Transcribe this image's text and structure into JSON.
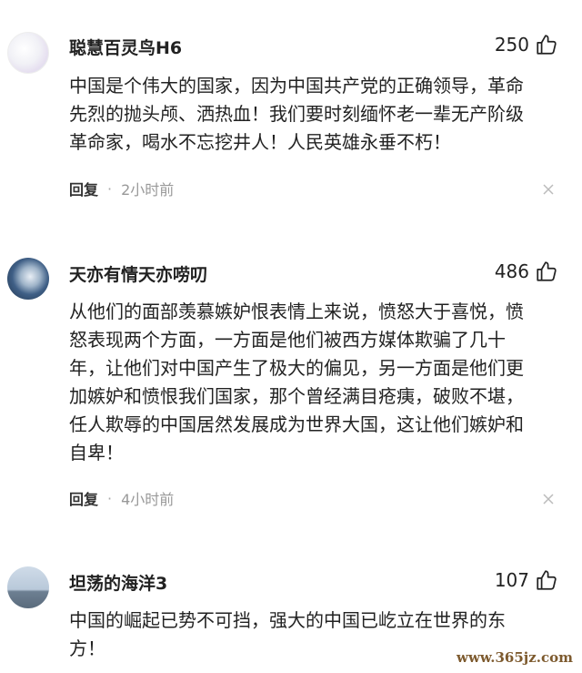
{
  "comments": [
    {
      "username": "聪慧百灵鸟H6",
      "likes": "250",
      "text": "中国是个伟大的国家，因为中国共产党的正确领导，革命\n先烈的抛头颅、洒热血！我们要时刻缅怀老一辈无产阶级\n革命家，喝水不忘挖井人！人民英雄永垂不朽！",
      "reply_label": "回复",
      "separator": "·",
      "time": "2小时前"
    },
    {
      "username": "天亦有情天亦唠叨",
      "likes": "486",
      "text": "从他们的面部羡慕嫉妒恨表情上来说，愤怒大于喜悦，愤\n怒表现两个方面，一方面是他们被西方媒体欺骗了几十\n年，让他们对中国产生了极大的偏见，另一方面是他们更\n加嫉妒和愤恨我们国家，那个曾经满目疮痍，破败不堪，\n任人欺辱的中国居然发展成为世界大国，这让他们嫉妒和\n自卑！",
      "reply_label": "回复",
      "separator": "·",
      "time": "4小时前"
    },
    {
      "username": "坦荡的海洋3",
      "likes": "107",
      "text": "中国的崛起已势不可挡，强大的中国已屹立在世界的东\n方！"
    }
  ],
  "watermark": "www.365jz.com"
}
